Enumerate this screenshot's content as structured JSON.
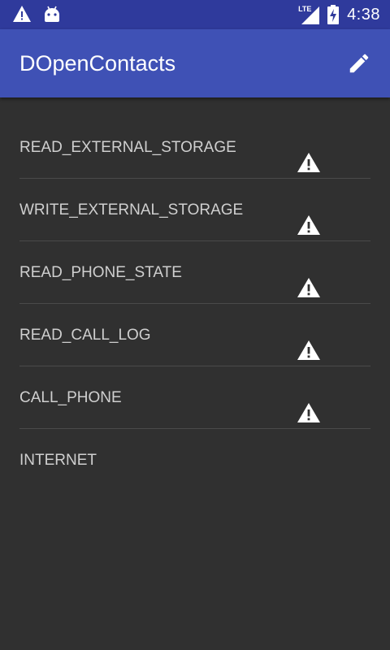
{
  "status_bar": {
    "time": "4:38",
    "network_label": "LTE",
    "icons": [
      "warning-icon",
      "android-icon",
      "signal-icon",
      "battery-charging-icon"
    ]
  },
  "app_bar": {
    "title": "DOpenContacts",
    "action_icon": "edit-icon"
  },
  "permissions": [
    {
      "label": "READ_EXTERNAL_STORAGE",
      "warning": true
    },
    {
      "label": "WRITE_EXTERNAL_STORAGE",
      "warning": true
    },
    {
      "label": "READ_PHONE_STATE",
      "warning": true
    },
    {
      "label": "READ_CALL_LOG",
      "warning": true
    },
    {
      "label": "CALL_PHONE",
      "warning": true
    },
    {
      "label": "INTERNET",
      "warning": false
    }
  ],
  "colors": {
    "status_bar": "#2f3a9c",
    "app_bar": "#3f51b5",
    "background": "#303030",
    "text": "#cfcfcf",
    "divider": "#4a4a4a"
  }
}
